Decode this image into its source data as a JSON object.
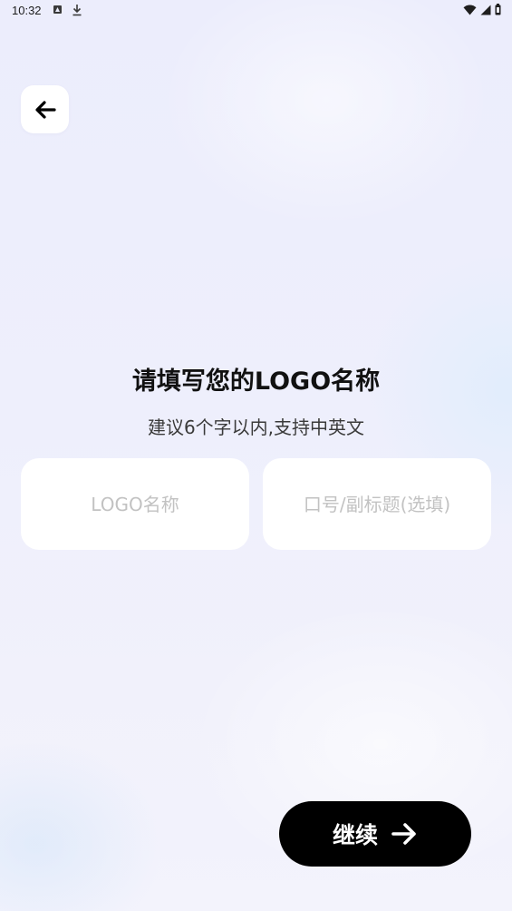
{
  "status_bar": {
    "time": "10:32",
    "icons": [
      "a-notification-icon",
      "download-icon",
      "wifi-icon",
      "signal-icon",
      "battery-icon"
    ]
  },
  "header": {
    "back_icon": "arrow-left-icon"
  },
  "main": {
    "title": "请填写您的LOGO名称",
    "subtitle": "建议6个字以内,支持中英文",
    "name_input": {
      "value": "",
      "placeholder": "LOGO名称"
    },
    "slogan_input": {
      "value": "",
      "placeholder": "口号/副标题(选填)"
    }
  },
  "footer": {
    "continue_label": "继续",
    "continue_icon": "arrow-right-icon"
  },
  "colors": {
    "primary_button": "#000000",
    "background": "#eeeffc",
    "card": "#ffffff",
    "placeholder": "#c2c2c2"
  }
}
